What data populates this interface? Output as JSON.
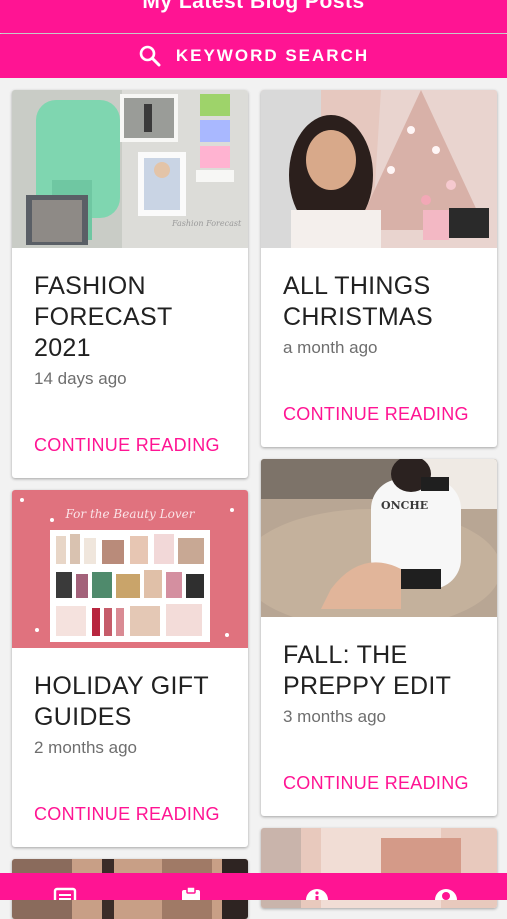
{
  "header": {
    "title": "My Latest Blog Posts"
  },
  "search": {
    "label": "KEYWORD SEARCH",
    "icon": "search-icon"
  },
  "posts": [
    {
      "title": "FASHION FORECAST 2021",
      "date": "14 days ago",
      "cta": "CONTINUE READING"
    },
    {
      "title": "ALL THINGS CHRISTMAS",
      "date": "a month ago",
      "cta": "CONTINUE READING"
    },
    {
      "title": "HOLIDAY GIFT GUIDES",
      "date": "2 months ago",
      "cta": "CONTINUE READING",
      "thumb_text": "For the Beauty Lover"
    },
    {
      "title": "FALL: THE PREPPY EDIT",
      "date": "3 months ago",
      "cta": "CONTINUE READING"
    }
  ],
  "bottom_nav": {
    "icons": [
      "blog-icon",
      "clipboard-icon",
      "info-icon",
      "profile-icon"
    ]
  },
  "colors": {
    "accent": "#ff1493",
    "card_bg": "#ffffff",
    "page_bg": "#f2f2f2"
  }
}
